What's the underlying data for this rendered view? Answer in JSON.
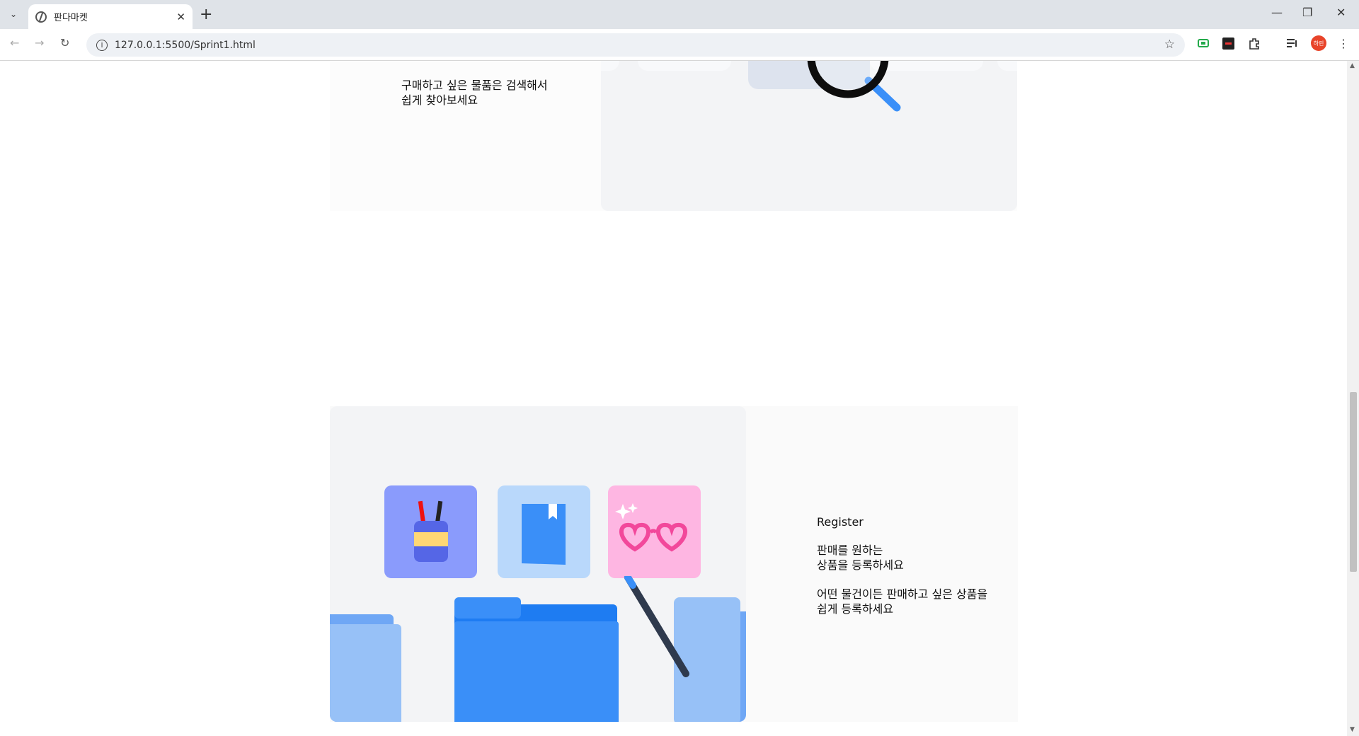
{
  "browser": {
    "tab_title": "판다마켓",
    "url": "127.0.0.1:5500/Sprint1.html",
    "profile_label": "하린"
  },
  "search_section": {
    "description": "구매하고 싶은 물품은 검색해서\n쉽게 찾아보세요"
  },
  "register_section": {
    "label": "Register",
    "headline": "판매를 원하는\n상품을 등록하세요",
    "description": "어떤 물건이든 판매하고 싶은 상품을\n쉽게 등록하세요"
  },
  "colors": {
    "accent_blue": "#3a8ff8",
    "card_purple": "#8a9bfc",
    "card_light_blue": "#b9d8fb",
    "card_pink": "#feb6e2"
  }
}
